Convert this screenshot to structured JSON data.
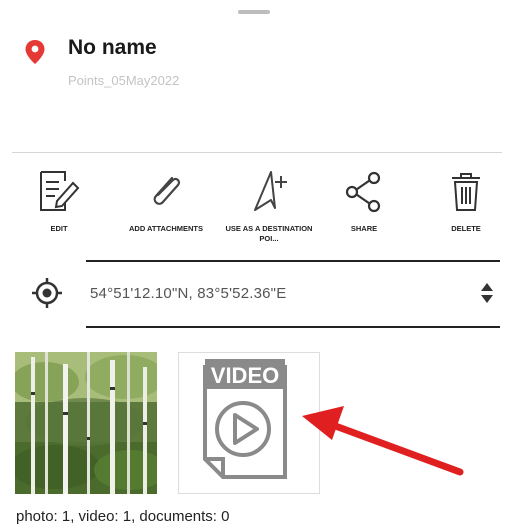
{
  "header": {
    "title": "No name",
    "subtitle": "Points_05May2022"
  },
  "actions": [
    {
      "label": "EDIT",
      "icon": "edit-icon"
    },
    {
      "label": "ADD ATTACHMENTS",
      "icon": "paperclip-icon"
    },
    {
      "label": "USE AS A DESTINATION POI...",
      "icon": "navigation-add-icon"
    },
    {
      "label": "SHARE",
      "icon": "share-icon"
    },
    {
      "label": "DELETE",
      "icon": "trash-icon"
    }
  ],
  "location": {
    "coordinates": "54°51'12.10\"N, 83°5'52.36\"E",
    "icon": "target-icon"
  },
  "attachments": {
    "video_badge": "VIDEO",
    "summary": "photo: 1, video: 1, documents: 0"
  },
  "colors": {
    "pin": "#e53935",
    "arrow": "#e02020",
    "video_icon": "#8a8a8a"
  }
}
